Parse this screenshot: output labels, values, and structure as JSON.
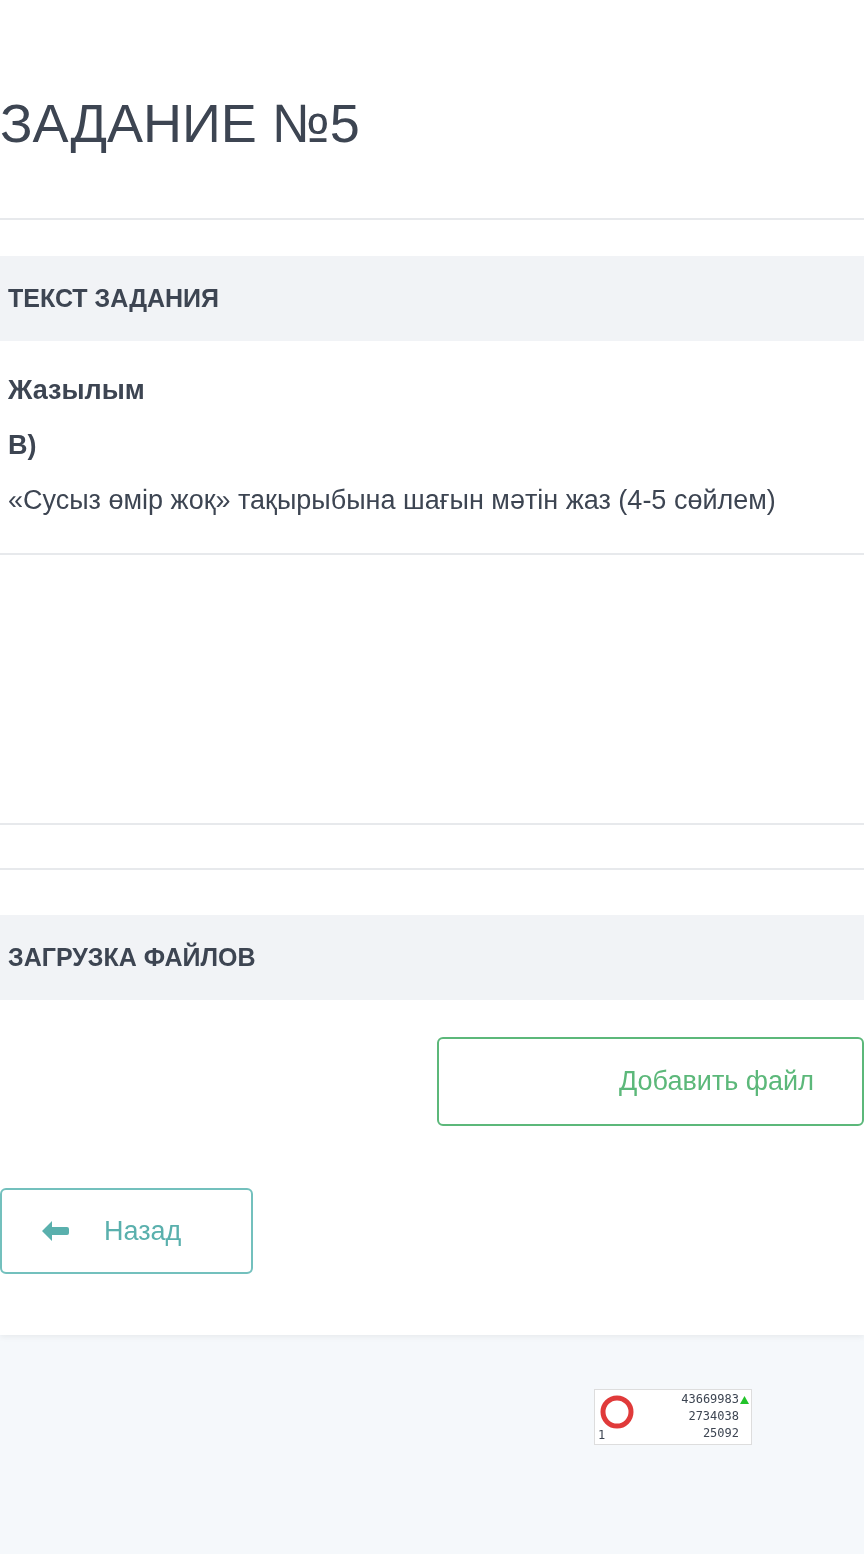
{
  "title": "ЗАДАНИЕ №5",
  "task_section": {
    "header": "ТЕКСТ ЗАДАНИЯ",
    "lines": [
      {
        "text": "Жазылым",
        "kind": "heading"
      },
      {
        "text": "В)",
        "kind": "heading"
      },
      {
        "text": "«Сусыз өмір жоқ» тақырыбына шағын мәтін жаз (4-5 сөйлем)",
        "kind": "plain"
      }
    ]
  },
  "upload_section": {
    "header": "ЗАГРУЗКА ФАЙЛОВ",
    "add_button": "Добавить файл"
  },
  "back_button": "Назад",
  "counter": {
    "corner": "1",
    "values": [
      "43669983",
      "2734038",
      "25092"
    ]
  }
}
